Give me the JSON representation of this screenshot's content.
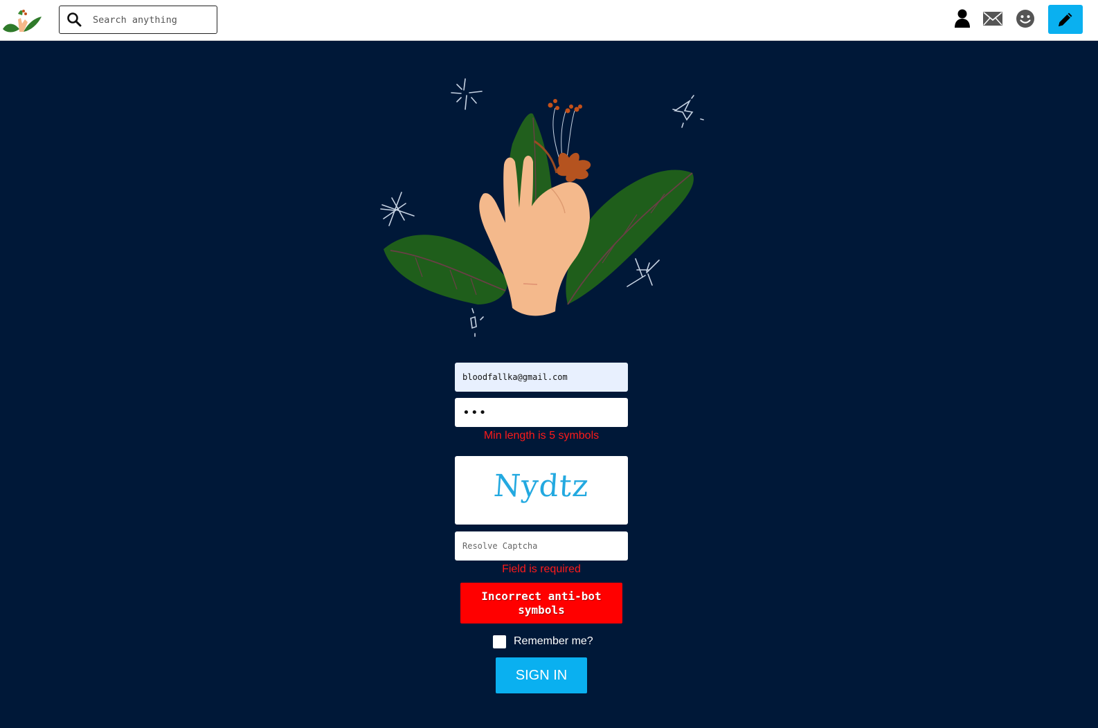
{
  "header": {
    "search": {
      "placeholder": "Search anything",
      "value": ""
    },
    "icons": [
      "user-icon",
      "mail-icon",
      "smiley-icon",
      "pencil-icon"
    ]
  },
  "form": {
    "email": {
      "value": "bloodfallka@gmail.com"
    },
    "password": {
      "value": "abc",
      "error": "Min length is 5 symbols"
    },
    "captcha": {
      "image_text": "Nydtz",
      "placeholder": "Resolve Captcha",
      "value": "",
      "error": "Field is required"
    },
    "alert": "Incorrect anti-bot symbols",
    "remember_label": "Remember me?",
    "remember_checked": false,
    "submit_label": "SIGN IN"
  },
  "colors": {
    "page_bg": "#001838",
    "accent": "#0ab0f0",
    "error": "#ff1a1a",
    "alert_bg": "#ff0000",
    "captcha_text": "#23a9e0"
  }
}
